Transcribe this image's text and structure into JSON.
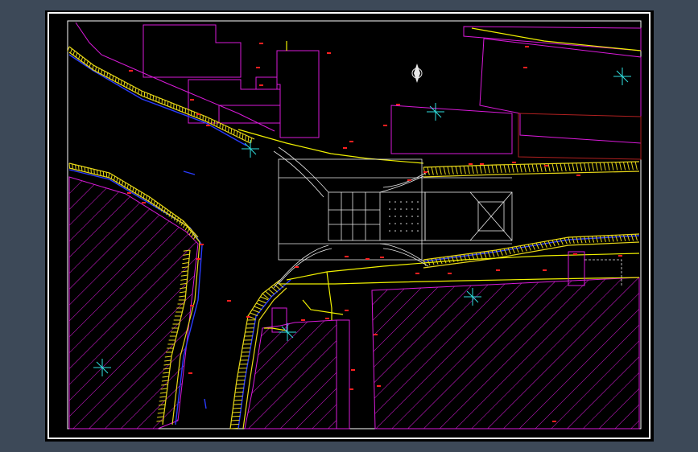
{
  "drawing": {
    "kind": "CAD site plan",
    "background_color": "#000000",
    "viewport_color": "#3d4958",
    "layer_colors": {
      "buildings": "#d91ad9",
      "curbs": "#e8d818",
      "road_edge": "#2a3cff",
      "center_line": "#f0f000",
      "plaza_lines": "#e8e8e8",
      "survey_points": "#30e0e0",
      "elevation_marks": "#ff2020"
    },
    "icons": {
      "north_arrow": "compass-north-icon",
      "survey_point": "crosshair-icon"
    }
  }
}
